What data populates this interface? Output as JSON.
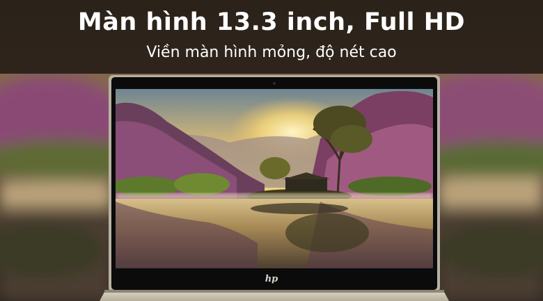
{
  "banner": {
    "title": "Màn hình 13.3 inch, Full HD",
    "subtitle": "Viền màn hình mỏng, độ nét cao"
  },
  "brand_logo": "hp",
  "colors": {
    "banner_bg": "#1c1612",
    "text": "#ffffff",
    "bezel": "#0b0b0c",
    "chassis": "#cfc6b4"
  }
}
